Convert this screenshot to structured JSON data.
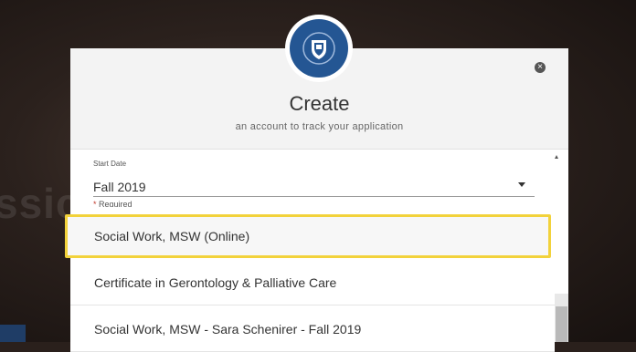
{
  "background": {
    "watermark_text": "ssic",
    "badge_text": ""
  },
  "modal": {
    "title": "Create",
    "subtitle": "an account to track your application",
    "close_symbol": "×",
    "logo_icon": "shield-crest-icon"
  },
  "start_date": {
    "label": "Start Date",
    "value": "Fall 2019",
    "required_text": "Required",
    "required_marker": "*"
  },
  "program_options": [
    {
      "label": "Social Work, MSW (Online)",
      "highlighted": true
    },
    {
      "label": "Certificate in Gerontology & Palliative Care",
      "highlighted": false
    },
    {
      "label": "Social Work, MSW - Sara Schenirer - Fall 2019",
      "highlighted": false
    }
  ],
  "colors": {
    "accent_yellow": "#f2d23b",
    "logo_blue": "#245693",
    "required_red": "#c0392b"
  }
}
